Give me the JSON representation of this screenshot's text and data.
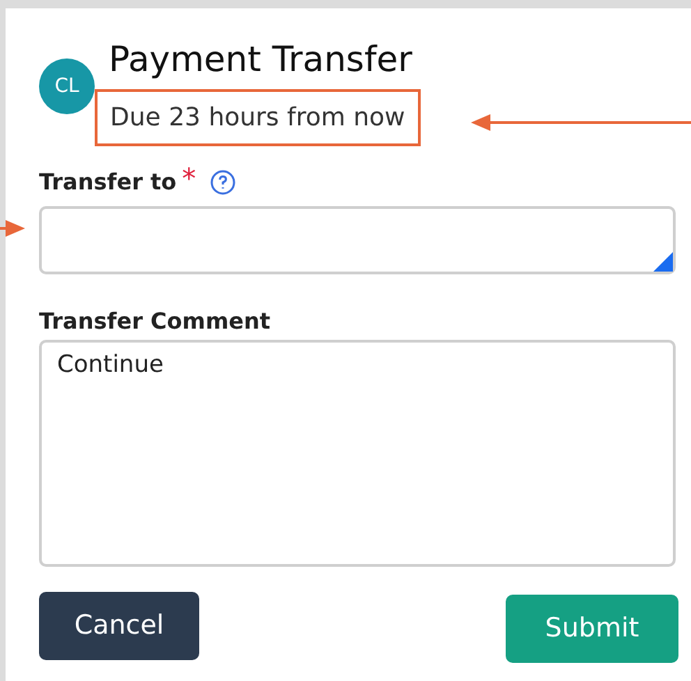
{
  "header": {
    "avatar": "CL",
    "title": "Payment Transfer",
    "subtitle": "Due 23 hours from now"
  },
  "fields": [
    {
      "kind": "input",
      "label": "Transfer to",
      "required_mark": "*",
      "help": true
    },
    {
      "kind": "textarea",
      "label": "Transfer Comment",
      "help": false,
      "value": "Continue"
    }
  ],
  "buttons": [
    {
      "label": "Cancel",
      "kind": "secondary"
    },
    {
      "label": "Submit",
      "kind": "primary"
    }
  ]
}
